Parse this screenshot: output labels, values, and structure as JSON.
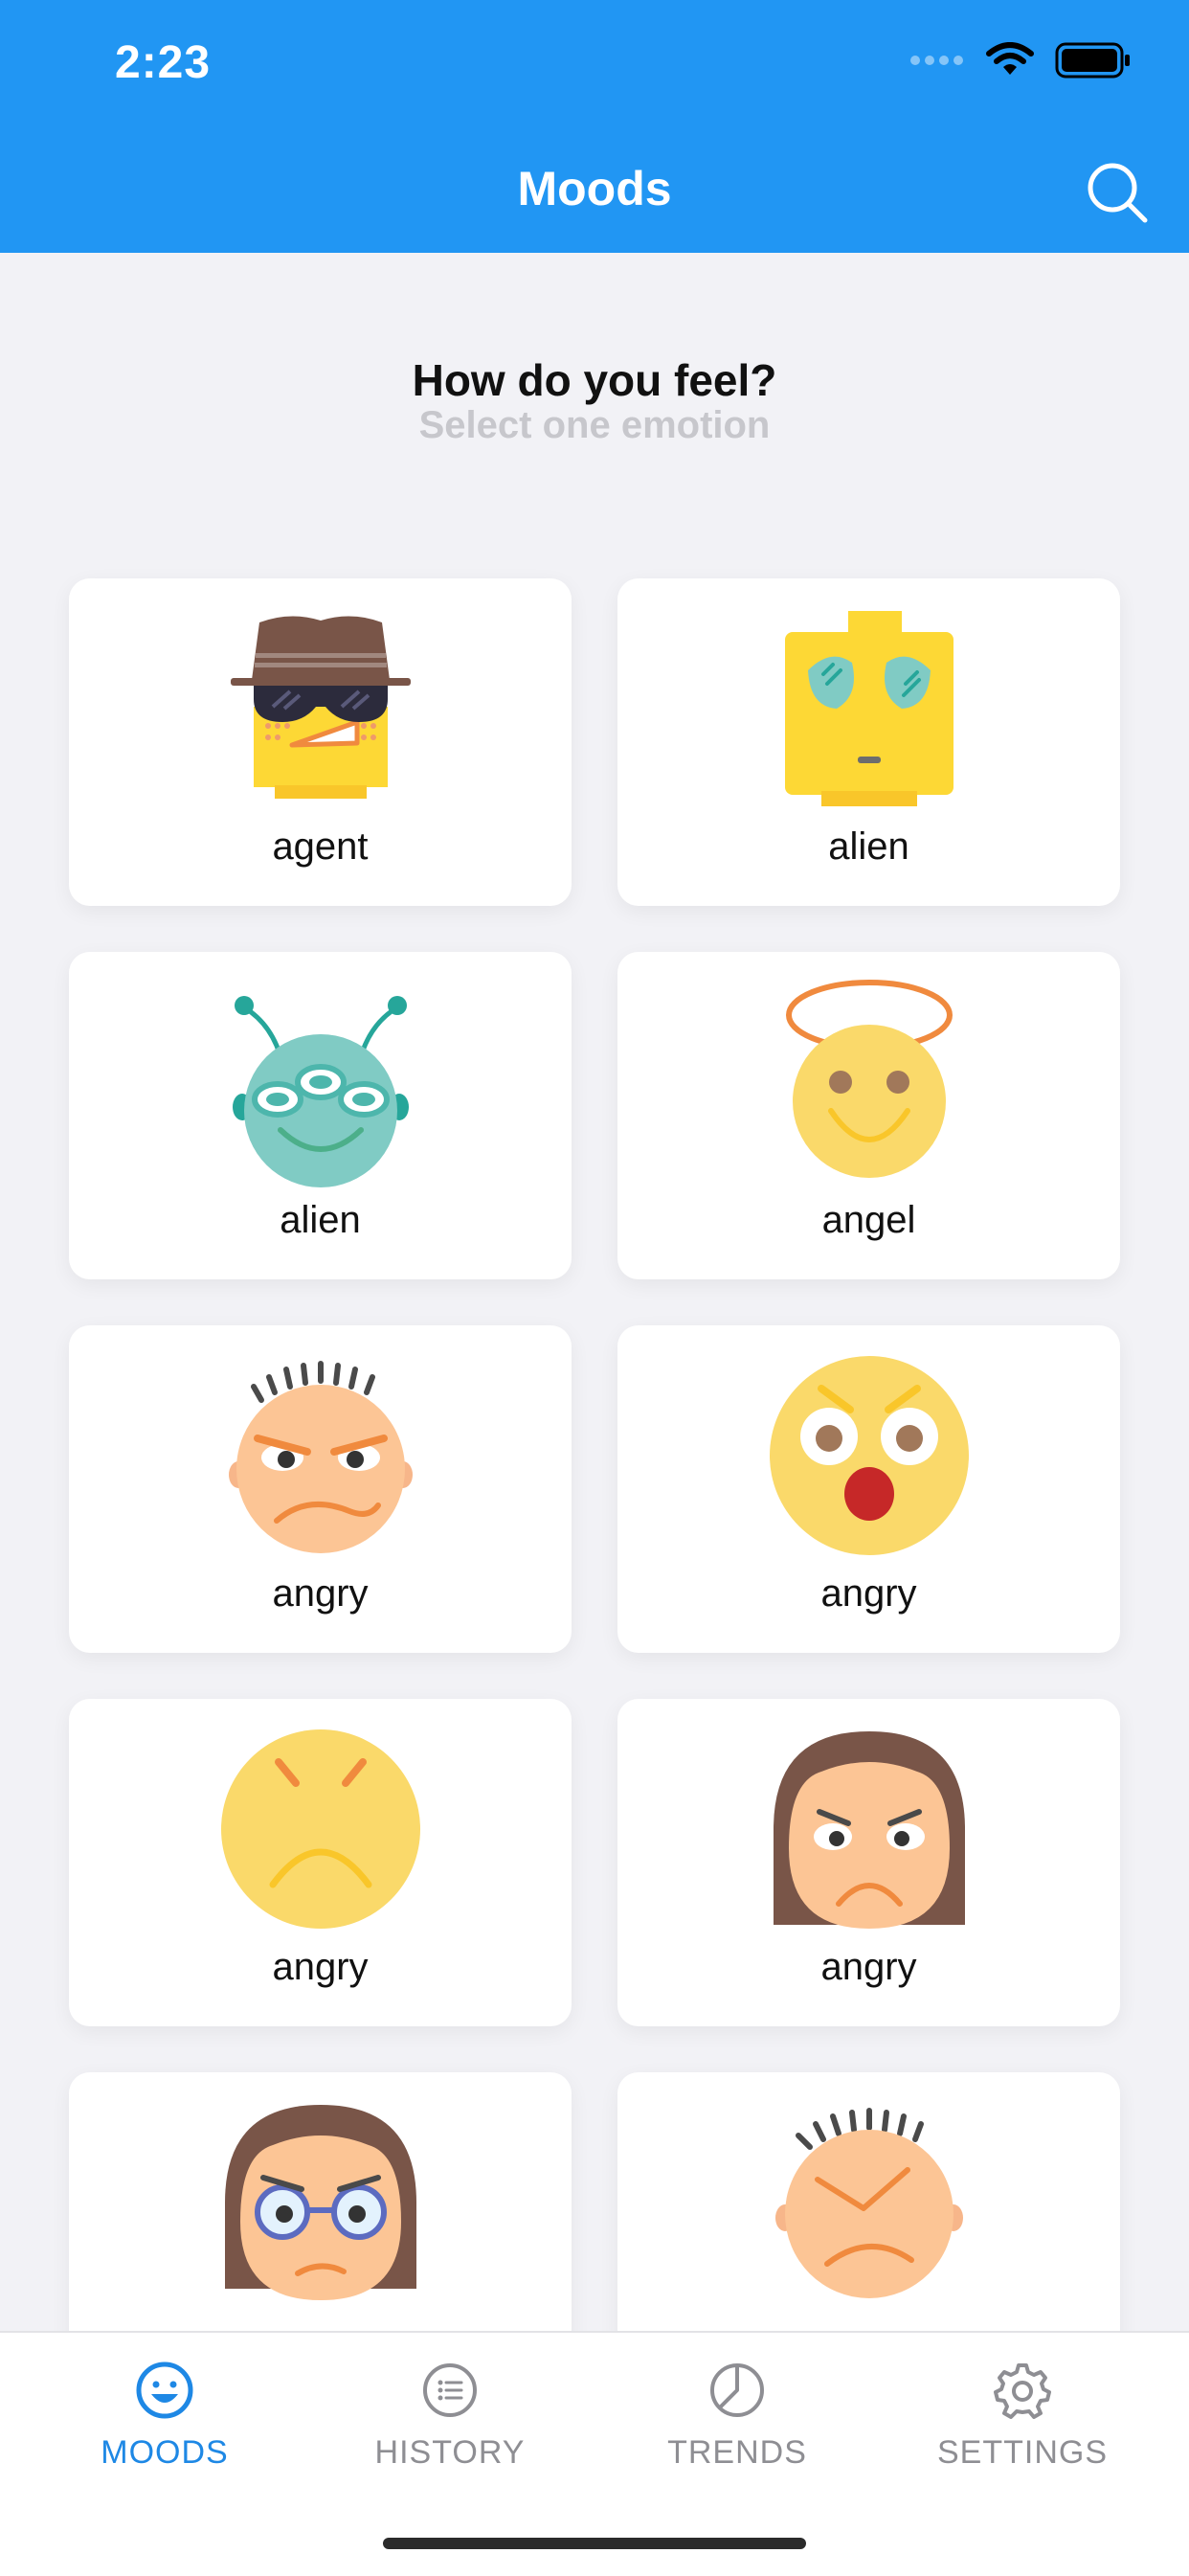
{
  "status_bar": {
    "time": "2:23"
  },
  "header": {
    "title": "Moods",
    "search_icon": "search-icon"
  },
  "prompt": {
    "title": "How do you feel?",
    "subtitle": "Select one emotion"
  },
  "moods": [
    {
      "label": "agent",
      "icon": "agent-icon"
    },
    {
      "label": "alien",
      "icon": "alien-robot-icon"
    },
    {
      "label": "alien",
      "icon": "alien-three-eyes-icon"
    },
    {
      "label": "angel",
      "icon": "angel-icon"
    },
    {
      "label": "angry",
      "icon": "angry-boy-icon"
    },
    {
      "label": "angry",
      "icon": "angry-shocked-icon"
    },
    {
      "label": "angry",
      "icon": "angry-frown-icon"
    },
    {
      "label": "angry",
      "icon": "angry-girl-icon"
    },
    {
      "label": "",
      "icon": "angry-glasses-girl-icon"
    },
    {
      "label": "",
      "icon": "angry-boy-scowl-icon"
    }
  ],
  "tabs": [
    {
      "label": "MOODS",
      "icon": "smiley-icon",
      "active": true
    },
    {
      "label": "HISTORY",
      "icon": "list-icon",
      "active": false
    },
    {
      "label": "TRENDS",
      "icon": "pie-chart-icon",
      "active": false
    },
    {
      "label": "SETTINGS",
      "icon": "gear-icon",
      "active": false
    }
  ],
  "colors": {
    "header": "#2196f3",
    "active_tab": "#1e88e5",
    "inactive_tab": "#8e8e93",
    "background": "#f2f2f6"
  }
}
